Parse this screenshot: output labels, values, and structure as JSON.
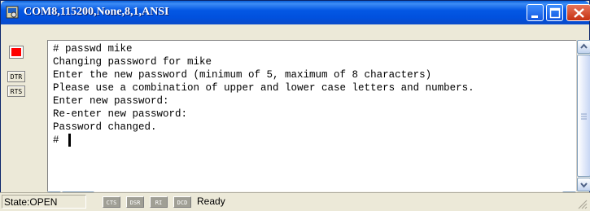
{
  "window": {
    "title": "COM8,115200,None,8,1,ANSI"
  },
  "indicators": {
    "dtr_label": "DTR",
    "rts_label": "RTS"
  },
  "terminal": {
    "lines": [
      "# passwd mike",
      "Changing password for mike",
      "Enter the new password (minimum of 5, maximum of 8 characters)",
      "Please use a combination of upper and lower case letters and numbers.",
      "Enter new password:",
      "Re-enter new password:",
      "Password changed.",
      "# "
    ]
  },
  "status": {
    "state": "State:OPEN",
    "cts": "CTS",
    "dsr": "DSR",
    "ri": "RI",
    "dcd": "DCD",
    "message": "Ready"
  },
  "colors": {
    "title_bar": "#0458e4",
    "indicator_red": "#ff0000"
  }
}
